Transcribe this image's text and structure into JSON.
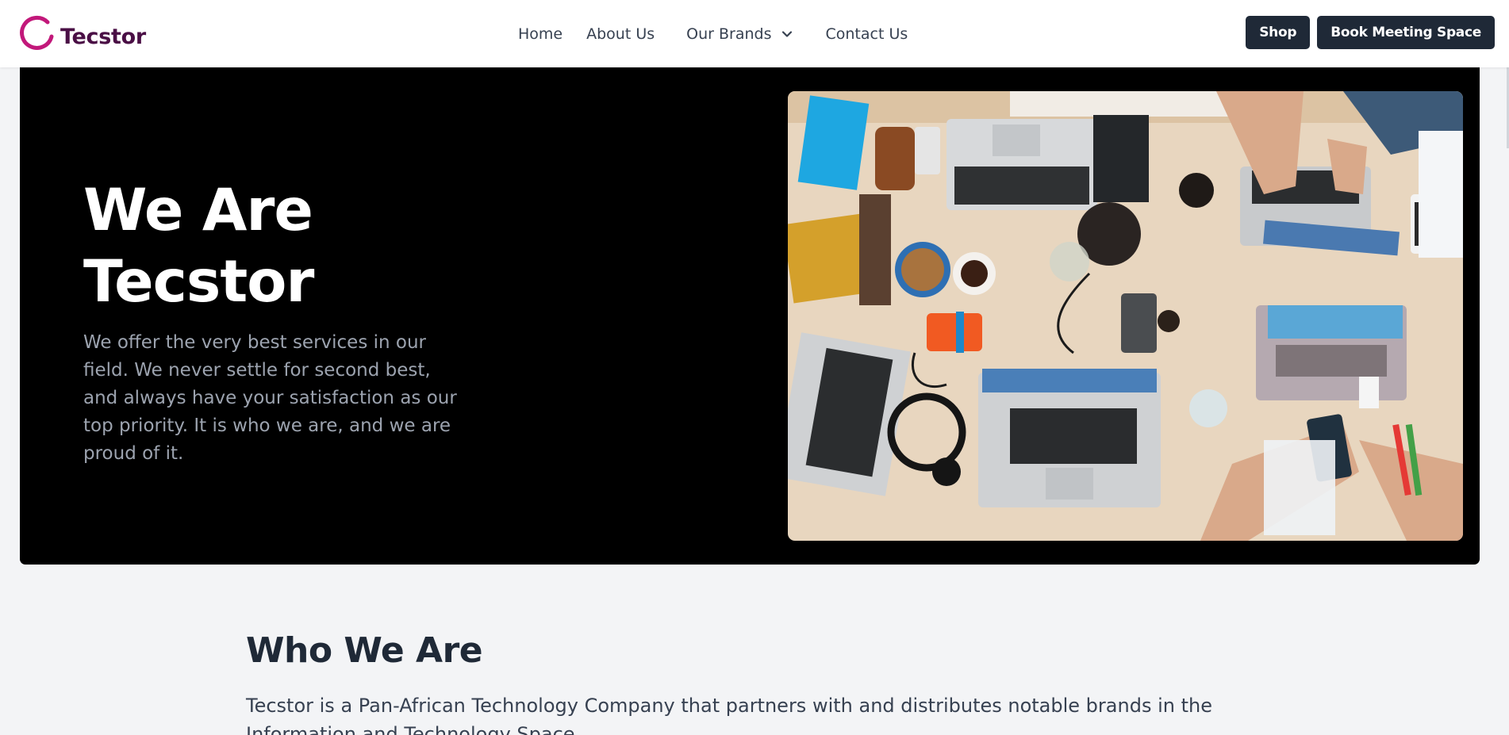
{
  "brand": {
    "name": "Tecstor",
    "logo_icon": "tecstor-ring-logo",
    "accent_color": "#c2187a",
    "text_color": "#4a0f45"
  },
  "nav": {
    "links": [
      {
        "label": "Home"
      },
      {
        "label": "About Us"
      },
      {
        "label": "Our Brands",
        "icon": "chevron-down-icon"
      },
      {
        "label": "Contact Us"
      }
    ],
    "buttons": {
      "shop": "Shop",
      "book": "Book Meeting Space"
    }
  },
  "hero": {
    "title_line1": "We Are",
    "title_line2": "Tecstor",
    "description": "We offer the very best services in our field. We never settle for second best, and always have your satisfaction as our top priority. It is who we are, and we are proud of it.",
    "image_subject": "overhead-photo-desk-laptops-people-working"
  },
  "who": {
    "title": "Who We Are",
    "description": "Tecstor is a Pan-African Technology Company that partners with and distributes notable brands in the Information and Technology Space."
  },
  "colors": {
    "page_bg": "#f3f4f6",
    "hero_bg": "#000000",
    "button_bg": "#1f2937"
  }
}
